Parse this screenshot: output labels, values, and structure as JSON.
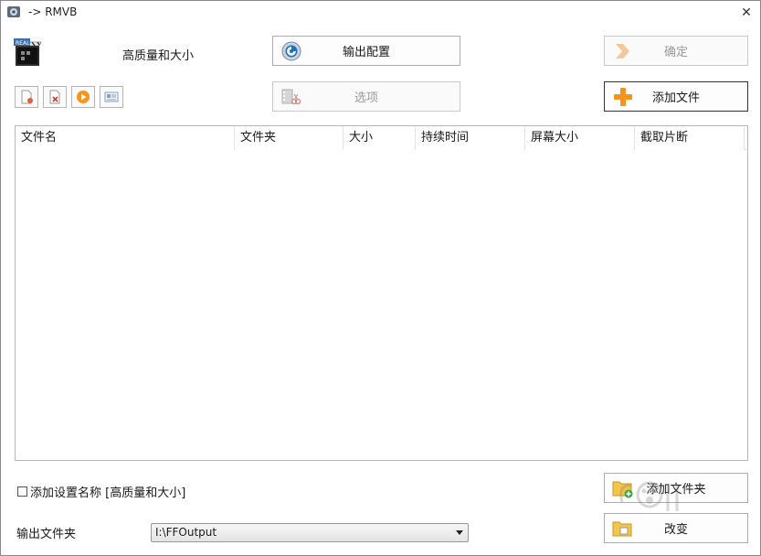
{
  "window": {
    "title": "-> RMVB"
  },
  "preset": {
    "name": "高质量和大小"
  },
  "buttons": {
    "output_config": "输出配置",
    "confirm": "确定",
    "options": "选项",
    "add_file": "添加文件",
    "add_folder": "添加文件夹",
    "change": "改变"
  },
  "file_list": {
    "columns": [
      "文件名",
      "文件夹",
      "大小",
      "持续时间",
      "屏幕大小",
      "截取片断"
    ]
  },
  "checkbox": {
    "label": "添加设置名称 [高质量和大小]",
    "checked": false
  },
  "output": {
    "label": "输出文件夹",
    "value": "I:\\FFOutput"
  },
  "colors": {
    "accent_orange": "#f7941d",
    "border": "#adadad"
  }
}
